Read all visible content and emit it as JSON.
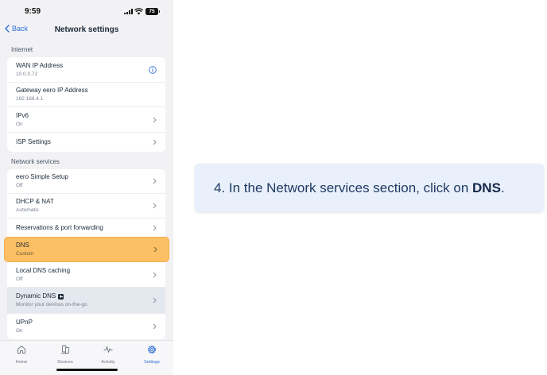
{
  "status_bar": {
    "time": "9:59",
    "battery": "75"
  },
  "nav": {
    "back_label": "Back",
    "title": "Network settings"
  },
  "internet": {
    "title": "Internet",
    "rows": [
      {
        "title": "WAN IP Address",
        "sub": "10.0.0.72",
        "icon": "info-icon"
      },
      {
        "title": "Gateway eero IP Address",
        "sub": "192.168.4.1"
      },
      {
        "title": "IPv6",
        "sub": "On",
        "icon": "chevron-right-icon"
      },
      {
        "title": "ISP Settings",
        "icon": "chevron-right-icon"
      }
    ]
  },
  "network_services": {
    "title": "Network services",
    "rows": [
      {
        "title": "eero Simple Setup",
        "sub": "Off"
      },
      {
        "title": "DHCP & NAT",
        "sub": "Automatic"
      },
      {
        "title": "Reservations & port forwarding"
      },
      {
        "title": "DNS",
        "sub": "Custom",
        "highlighted": true
      },
      {
        "title": "Local DNS caching",
        "sub": "Off"
      },
      {
        "title": "Dynamic DNS",
        "sub": "Monitor your devices on-the-go",
        "badge": "plus-icon"
      },
      {
        "title": "UPnP",
        "sub": "On"
      }
    ]
  },
  "tabs": [
    {
      "label": "Home",
      "icon": "home-icon"
    },
    {
      "label": "Devices",
      "icon": "devices-icon"
    },
    {
      "label": "Activity",
      "icon": "activity-icon"
    },
    {
      "label": "Settings",
      "icon": "gear-icon",
      "active": true
    }
  ],
  "instruction": {
    "prefix": "4. In the Network services section, click on ",
    "target": "DNS",
    "suffix": "."
  },
  "colors": {
    "accent": "#2f6fd8",
    "highlight": "#fdbf63",
    "instruction_bg": "#e9f0fb",
    "text_dark": "#1c2a39"
  }
}
